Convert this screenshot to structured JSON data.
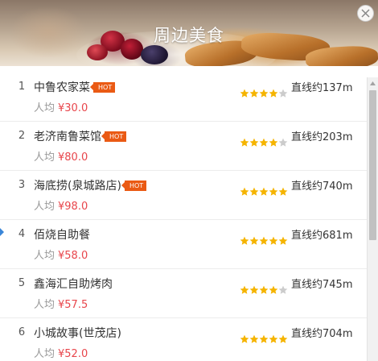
{
  "header": {
    "title": "周边美食",
    "close_icon": "close-icon"
  },
  "colors": {
    "hot_badge": "#ea5a14",
    "price": "#e8454b",
    "star_on": "#f5b400",
    "star_off": "#cccccc",
    "side_marker": "#3a86d8"
  },
  "restaurants": [
    {
      "index": "1",
      "name": "中鲁农家菜",
      "hot": "HOT",
      "price_label": "人均",
      "price": "¥30.0",
      "rating": 4,
      "rating_max": 5,
      "distance": "直线约137m"
    },
    {
      "index": "2",
      "name": "老济南鲁菜馆",
      "hot": "HOT",
      "price_label": "人均",
      "price": "¥80.0",
      "rating": 4,
      "rating_max": 5,
      "distance": "直线约203m"
    },
    {
      "index": "3",
      "name": "海底捞(泉城路店)",
      "hot": "HOT",
      "price_label": "人均",
      "price": "¥98.0",
      "rating": 5,
      "rating_max": 5,
      "distance": "直线约740m"
    },
    {
      "index": "4",
      "name": "佰烧自助餐",
      "hot": "",
      "price_label": "人均",
      "price": "¥58.0",
      "rating": 5,
      "rating_max": 5,
      "distance": "直线约681m"
    },
    {
      "index": "5",
      "name": "鑫海汇自助烤肉",
      "hot": "",
      "price_label": "人均",
      "price": "¥57.5",
      "rating": 4,
      "rating_max": 5,
      "distance": "直线约745m"
    },
    {
      "index": "6",
      "name": "小城故事(世茂店)",
      "hot": "",
      "price_label": "人均",
      "price": "¥52.0",
      "rating": 5,
      "rating_max": 5,
      "distance": "直线约704m"
    }
  ],
  "scrollbar": {
    "position_fraction": 0.0,
    "visible_fraction": 0.53
  }
}
